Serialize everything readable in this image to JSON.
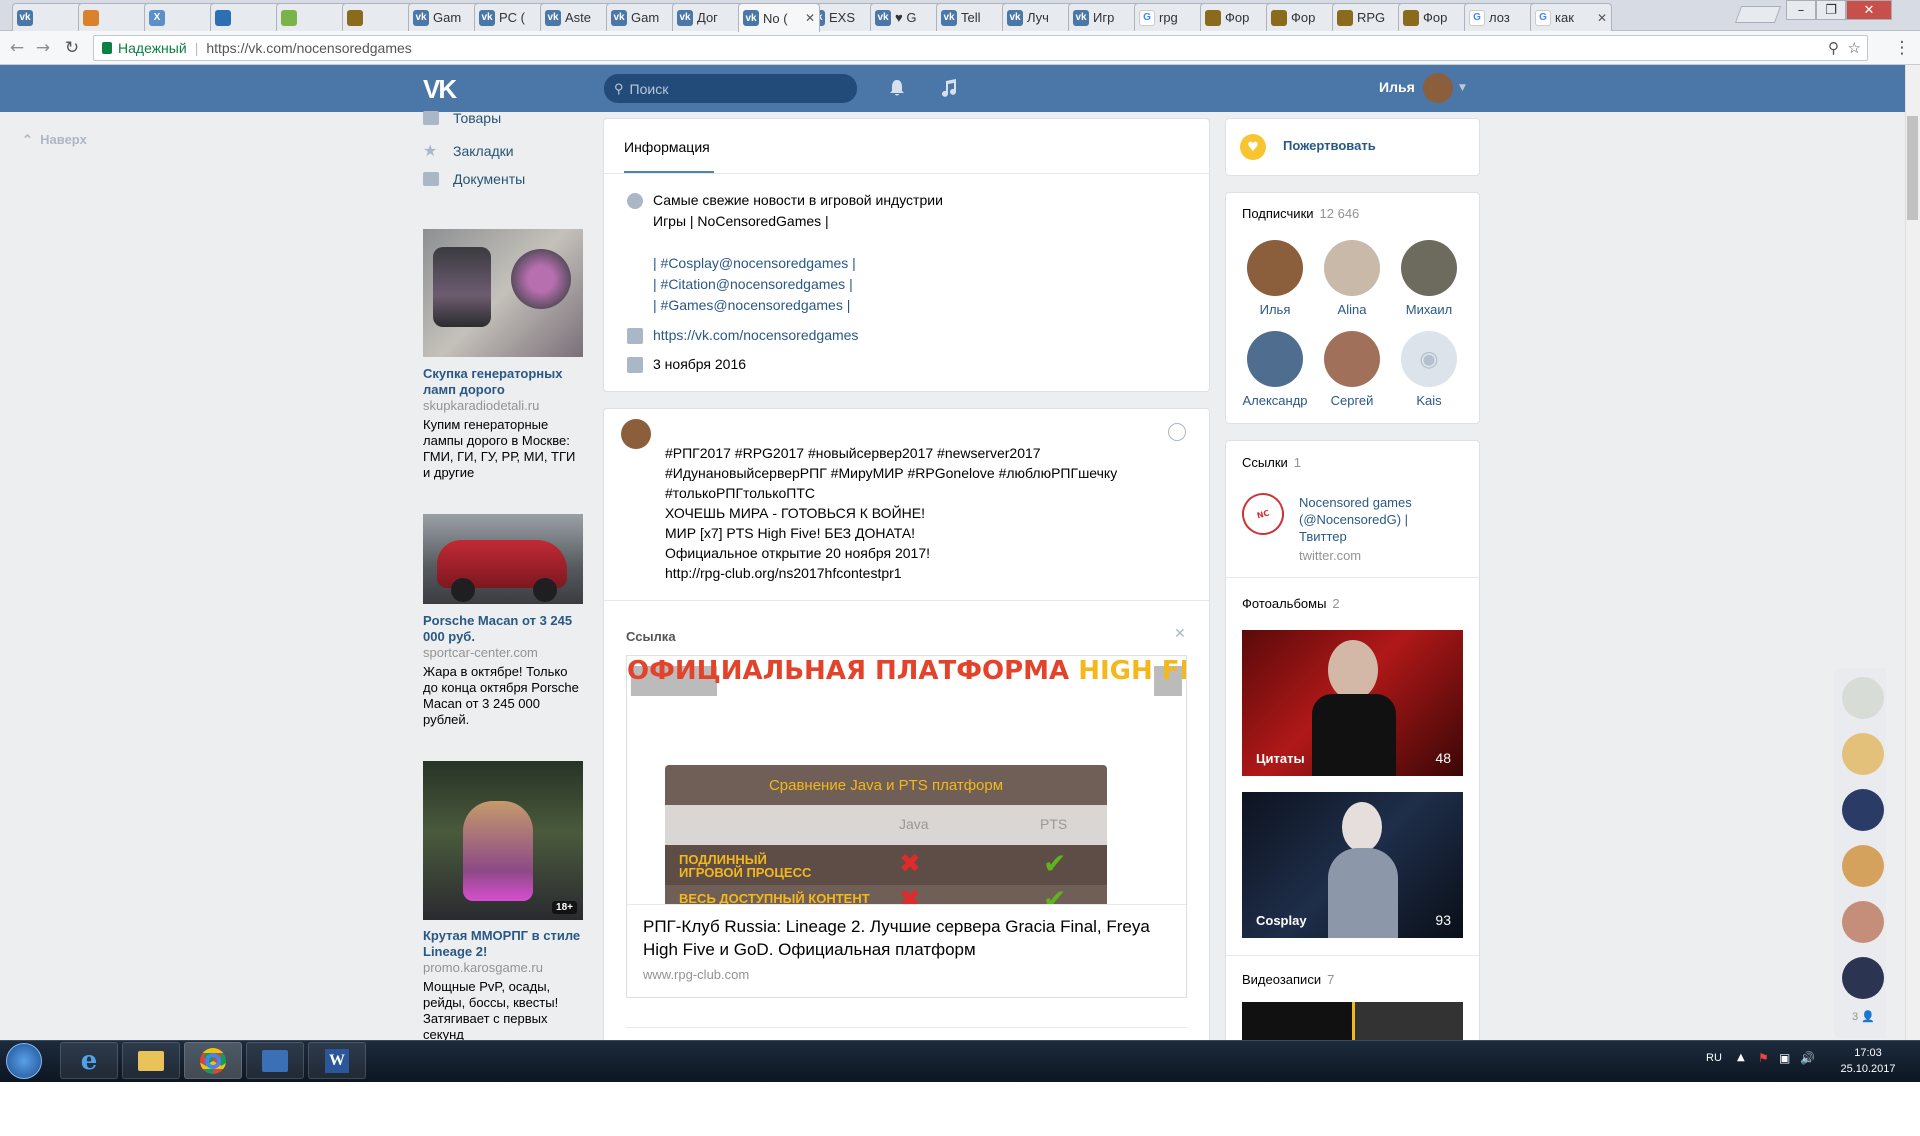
{
  "browser": {
    "tabs": [
      {
        "label": "",
        "icon": "vk-icon"
      },
      {
        "label": "",
        "icon": "firefox-like-icon"
      },
      {
        "label": "",
        "icon": "x-icon"
      },
      {
        "label": "",
        "icon": "mountain-icon"
      },
      {
        "label": "",
        "icon": "green-icon"
      },
      {
        "label": "",
        "icon": "game-icon"
      },
      {
        "label": "Gam",
        "icon": "vk-icon"
      },
      {
        "label": "PC (",
        "icon": "vk-icon"
      },
      {
        "label": "Aste",
        "icon": "vk-icon"
      },
      {
        "label": "Gam",
        "icon": "vk-icon"
      },
      {
        "label": "Дог",
        "icon": "vk-icon"
      },
      {
        "label": "No (",
        "icon": "vk-icon"
      },
      {
        "label": "EXS",
        "icon": "vk-icon"
      },
      {
        "label": "♥ G",
        "icon": "vk-icon"
      },
      {
        "label": "Tell",
        "icon": "vk-icon"
      },
      {
        "label": "Луч",
        "icon": "vk-icon"
      },
      {
        "label": "Игр",
        "icon": "vk-icon"
      },
      {
        "label": "rpg",
        "icon": "google-icon"
      },
      {
        "label": "Фор",
        "icon": "game-icon"
      },
      {
        "label": "Фор",
        "icon": "game-icon"
      },
      {
        "label": "RPG",
        "icon": "game-icon"
      },
      {
        "label": "Фор",
        "icon": "game-icon"
      },
      {
        "label": "лоз",
        "icon": "google-icon"
      },
      {
        "label": "как",
        "icon": "google-icon"
      }
    ],
    "secure_label": "Надежный",
    "url": "https://vk.com/nocensoredgames"
  },
  "vk_header": {
    "logo": "VK",
    "search_placeholder": "Поиск",
    "user_name": "Илья"
  },
  "left": {
    "back_to_top": "Наверх",
    "nav": [
      {
        "label": "Товары",
        "icon": "bag-icon"
      },
      {
        "label": "Закладки",
        "icon": "star-icon"
      },
      {
        "label": "Документы",
        "icon": "document-icon"
      }
    ],
    "ads": [
      {
        "title": "Скупка генераторных ламп дорого",
        "domain": "skupkaradiodetali.ru",
        "body": "Купим генераторные лампы дорого в Москве: ГМИ, ГИ, ГУ, РР, МИ, ТГИ и другие"
      },
      {
        "title": "Porsche Macan от 3 245 000 руб.",
        "domain": "sportcar-center.com",
        "body": "Жара в октябре! Только до конца октября Porsche Macan от 3 245 000 рублей."
      },
      {
        "title": "Крутая ММОРПГ в стиле Lineage 2!",
        "domain": "promo.karosgame.ru",
        "body": "Мощные PvP, осады, рейды, боссы, квесты! Затягивает с первых секунд",
        "badge": "18+"
      }
    ]
  },
  "info": {
    "tab": "Информация",
    "desc_lines": [
      "Самые свежие новости в игровой индустрии",
      "Игры | NoCensoredGames |",
      "",
      "| #Cosplay@nocensoredgames |",
      "| #Citation@nocensoredgames |",
      "| #Games@nocensoredgames |"
    ],
    "site": "https://vk.com/nocensoredgames",
    "date": "3 ноября 2016"
  },
  "post": {
    "lines": [
      "#РПГ2017 #RPG2017 #новыйсервер2017 #newserver2017",
      "#ИдунановыйсерверРПГ #МируМИР #RPGonelove #люблюРПГшечку",
      "#толькоРПГтолькоПТС",
      "ХОЧЕШЬ МИРА - ГОТОВЬСЯ К ВОЙНЕ!",
      "МИР [x7] PTS High Five! БЕЗ ДОНАТА!",
      "Официальное открытие 20 ноября 2017!",
      "http://rpg-club.org/ns2017hfcontestpr1"
    ],
    "attach_label": "Ссылка",
    "banner_title_a": "ОФИЦИАЛЬНАЯ ПЛАТФОРМА ",
    "banner_title_b": "HIGH FIVE",
    "table_title": "Сравнение Java и PTS платформ",
    "col_java": "Java",
    "col_pts": "PTS",
    "row1": "ПОДЛИННЫЙ ИГРОВОЙ ПРОЦЕСС",
    "row2": "ВЕСЬ ДОСТУПНЫЙ КОНТЕНТ",
    "link_title": "РПГ-Клуб Russia: Lineage 2. Лучшие сервера Gracia Final, Freya High Five и GoD. Официальная платформ",
    "link_domain": "www.rpg-club.com"
  },
  "right": {
    "donate": "Пожертвовать",
    "subscribers_label": "Подписчики",
    "subscribers_count": "12 646",
    "subscribers": [
      {
        "name": "Илья",
        "color": "#8b5e3c"
      },
      {
        "name": "Alina",
        "color": "#c9b9a8"
      },
      {
        "name": "Михаил",
        "color": "#6d6a5e"
      },
      {
        "name": "Александр",
        "color": "#4f6e8f"
      },
      {
        "name": "Сергей",
        "color": "#a0705a"
      },
      {
        "name": "Kais",
        "color": "#dde3ea"
      }
    ],
    "links_label": "Ссылки",
    "links_count": "1",
    "link_name": "Nocensored games (@NocensoredG) | Твиттер",
    "link_domain": "twitter.com",
    "albums_label": "Фотоальбомы",
    "albums_count": "2",
    "albums": [
      {
        "name": "Цитаты",
        "count": "48"
      },
      {
        "name": "Cosplay",
        "count": "93"
      }
    ],
    "videos_label": "Видеозаписи",
    "videos_count": "7"
  },
  "chat_count": "3",
  "taskbar": {
    "lang": "RU",
    "time": "17:03",
    "date": "25.10.2017"
  }
}
